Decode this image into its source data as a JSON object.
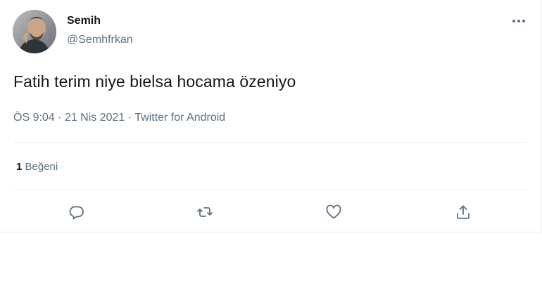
{
  "tweet": {
    "author": {
      "display_name": "Semih",
      "handle": "@Semhfrkan",
      "avatar_icon": "user-avatar-photo"
    },
    "text": "Fatih terim niye bielsa hocama özeniyo",
    "meta": {
      "time": "ÖS 9:04",
      "separator": " · ",
      "date": "21 Nis 2021",
      "source": "Twitter for Android"
    },
    "stats": {
      "likes_count": "1",
      "likes_label": "Beğeni"
    },
    "actions": [
      {
        "name": "reply",
        "icon": "reply-icon"
      },
      {
        "name": "retweet",
        "icon": "retweet-icon"
      },
      {
        "name": "like",
        "icon": "heart-icon"
      },
      {
        "name": "share",
        "icon": "share-icon"
      }
    ],
    "menu_icon": "more-icon"
  },
  "colors": {
    "text_primary": "#14171a",
    "text_secondary": "#5b7083",
    "divider": "#e6ecf0",
    "background": "#ffffff"
  }
}
